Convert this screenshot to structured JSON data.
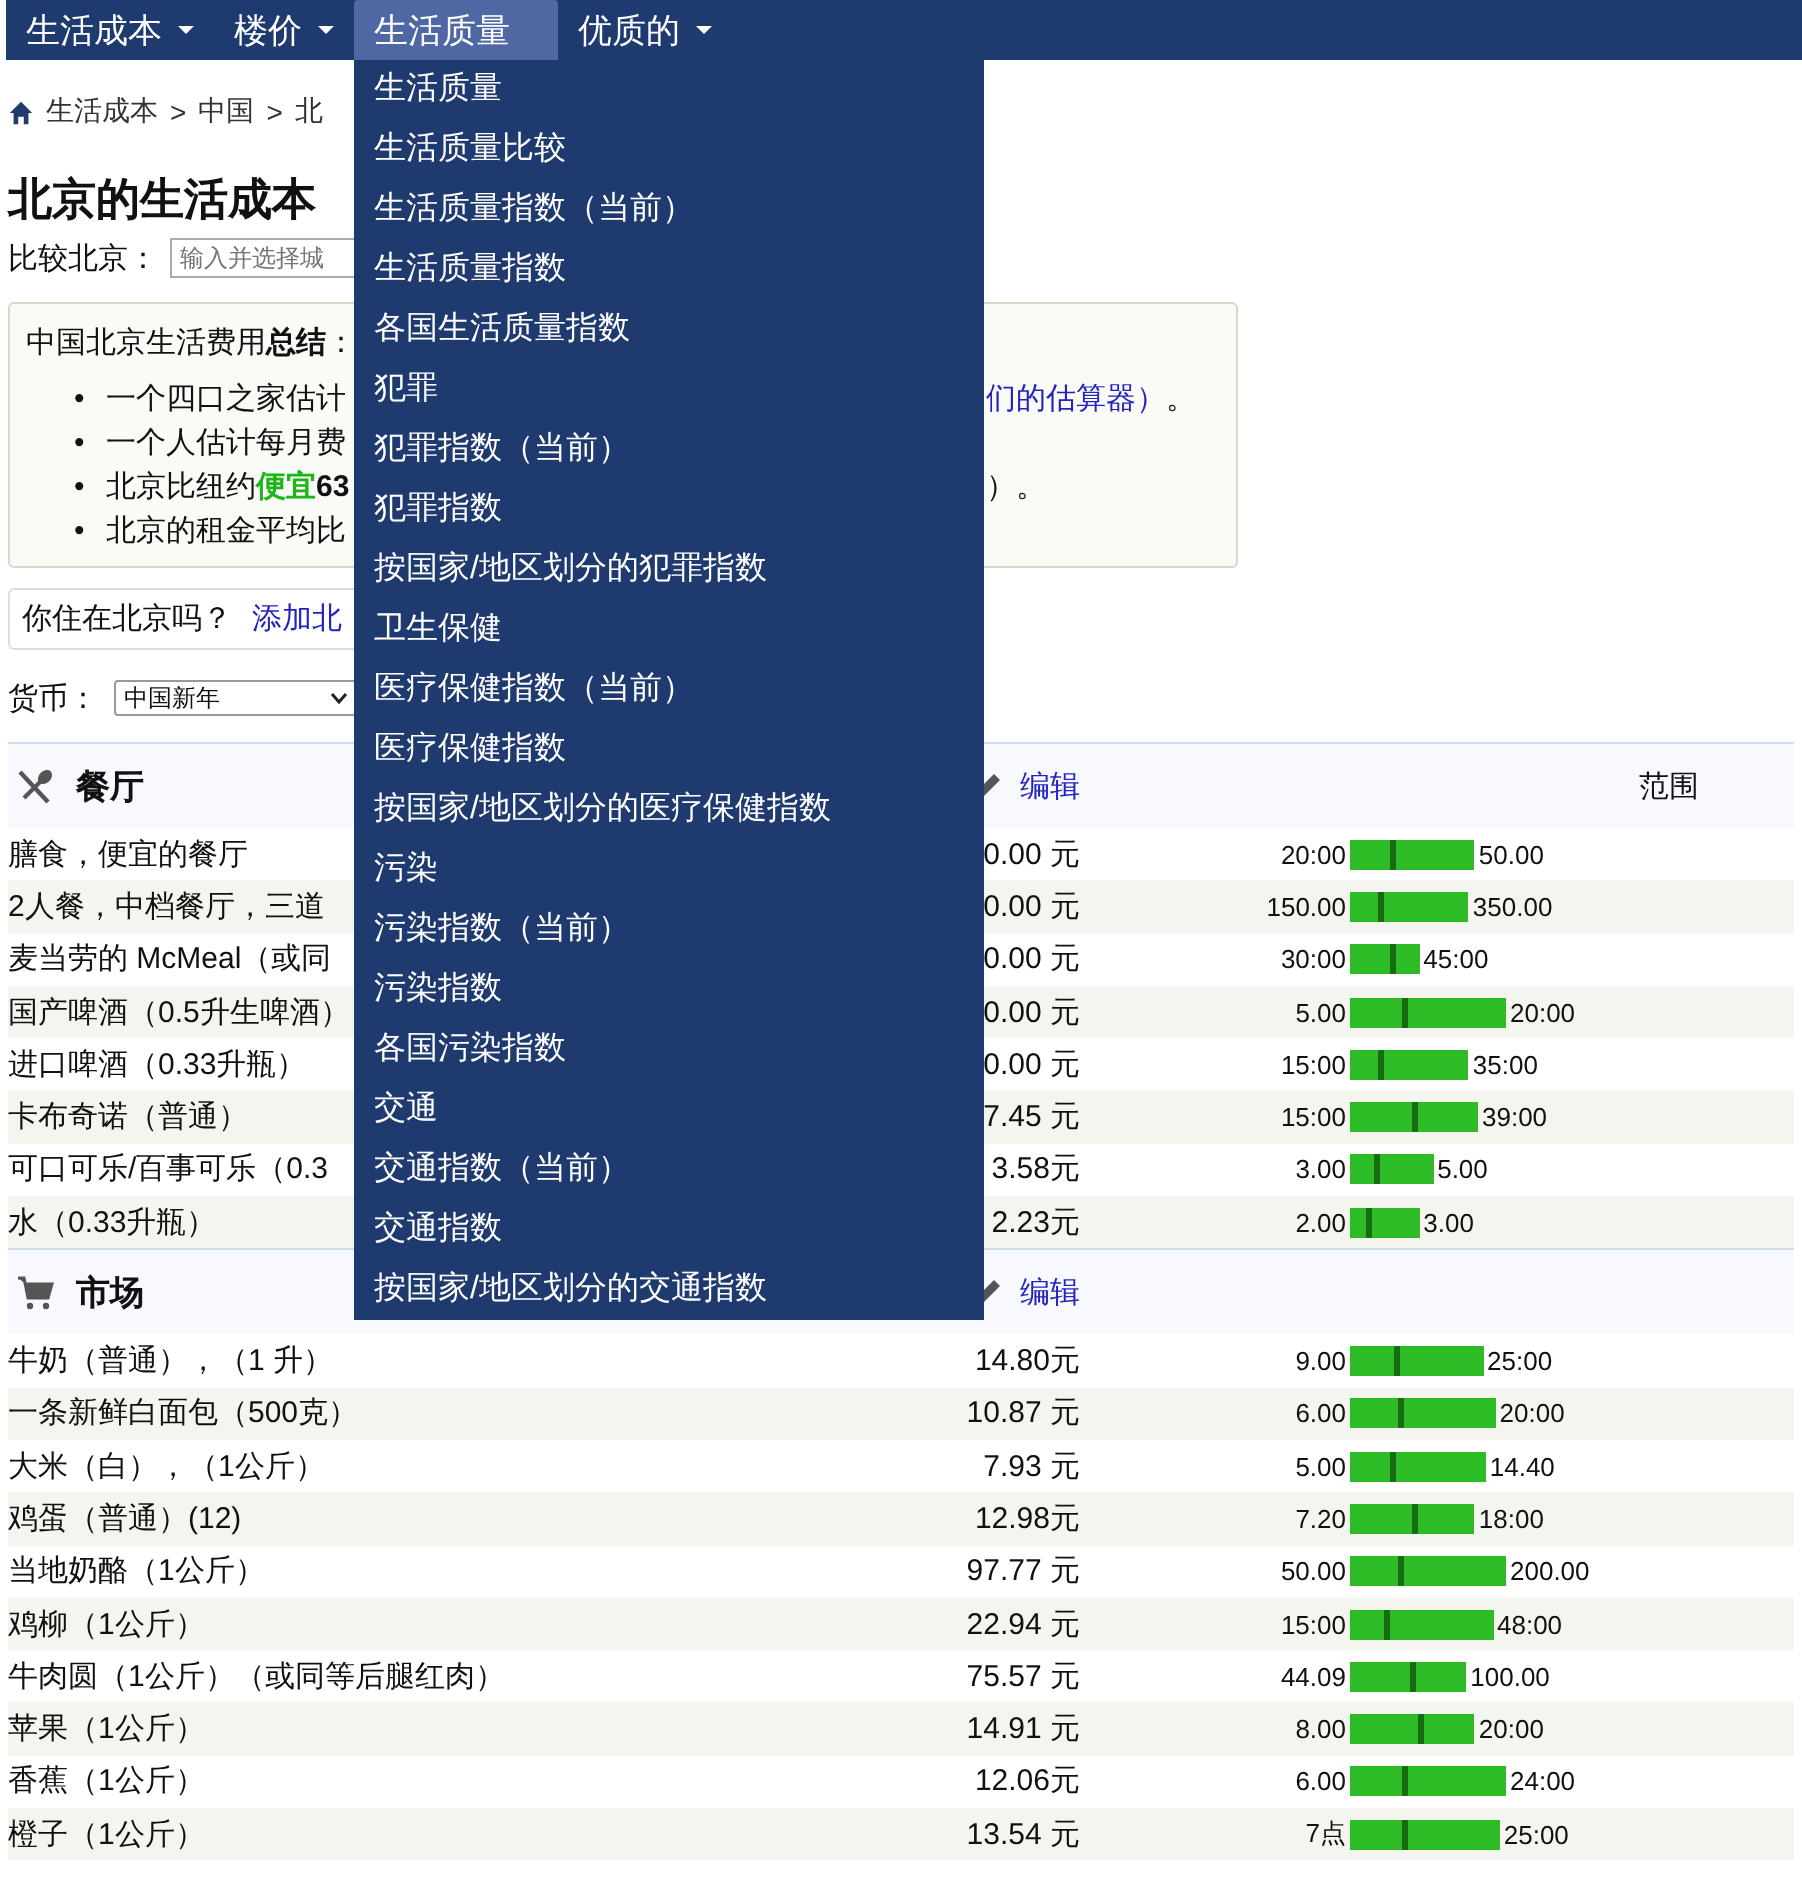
{
  "nav": {
    "items": [
      {
        "label": "生活成本",
        "selected": false,
        "caret": true
      },
      {
        "label": "楼价",
        "selected": false,
        "caret": true
      },
      {
        "label": "生活质量",
        "selected": true,
        "caret": false
      },
      {
        "label": "优质的",
        "selected": false,
        "caret": true
      }
    ]
  },
  "dropdown": {
    "items": [
      "生活质量",
      "生活质量比较",
      "生活质量指数（当前）",
      "生活质量指数",
      "各国生活质量指数",
      "犯罪",
      "犯罪指数（当前）",
      "犯罪指数",
      "按国家/地区划分的犯罪指数",
      "卫生保健",
      "医疗保健指数（当前）",
      "医疗保健指数",
      "按国家/地区划分的医疗保健指数",
      "污染",
      "污染指数（当前）",
      "污染指数",
      "各国污染指数",
      "交通",
      "交通指数（当前）",
      "交通指数",
      "按国家/地区划分的交通指数"
    ]
  },
  "breadcrumb": [
    "生活成本",
    ">",
    "中国",
    ">",
    "北"
  ],
  "title": "北京的生活成本",
  "compare": {
    "label": "比较北京：",
    "placeholder": "输入并选择城"
  },
  "summary": {
    "heading": "中国北京生活费用**总结**：",
    "bullets": [
      {
        "marker": "•",
        "parts": [
          {
            "kind": "plain",
            "text": "一个四口之家估计"
          }
        ],
        "link": "们的估算器）",
        "tail": "。"
      },
      {
        "marker": "•",
        "parts": [
          {
            "kind": "plain",
            "text": "一个人估计每月费"
          }
        ]
      },
      {
        "marker": "•",
        "parts": [
          {
            "kind": "plain",
            "text": "北京比纽约"
          },
          {
            "kind": "highlight",
            "text": "便宜"
          },
          {
            "kind": "bold",
            "text": "63"
          }
        ],
        "tail": "）。"
      },
      {
        "marker": "•",
        "parts": [
          {
            "kind": "plain",
            "text": "北京的租金平均比"
          }
        ]
      }
    ]
  },
  "live_here": {
    "question": "你住在北京吗？",
    "link": "添加北"
  },
  "currency": {
    "label": "货币：",
    "value": "中国新年"
  },
  "sections": [
    {
      "kind": "restaurant",
      "title": "餐厅",
      "edit": "编辑",
      "range_header": "范围",
      "rows": [
        {
          "name": "膳食，便宜的餐厅",
          "price": "0.00 元",
          "low": "20:00",
          "high": "50.00",
          "level": 0.34
        },
        {
          "name": "2人餐，中档餐厅，三道",
          "price": "0.00 元",
          "low": "150.00",
          "high": "350.00",
          "level": 0.26
        },
        {
          "name": "麦当劳的 McMeal（或同",
          "price": "0.00 元",
          "low": "30:00",
          "high": "45:00",
          "level": 0.6
        },
        {
          "name": "国产啤酒（0.5升生啤酒）",
          "price": "0.00 元",
          "low": "5.00",
          "high": "20:00",
          "level": 0.34
        },
        {
          "name": "进口啤酒（0.33升瓶）",
          "price": "0.00 元",
          "low": "15:00",
          "high": "35:00",
          "level": 0.26
        },
        {
          "name": "卡布奇诺（普通）",
          "price": "7.45 元",
          "low": "15:00",
          "high": "39:00",
          "level": 0.5
        },
        {
          "name": "可口可乐/百事可乐（0.3",
          "price": "3.58元",
          "low": "3.00",
          "high": "5.00",
          "level": 0.31
        },
        {
          "name": "水（0.33升瓶）",
          "price": "2.23元",
          "low": "2.00",
          "high": "3.00",
          "level": 0.26
        }
      ]
    },
    {
      "kind": "market",
      "title": "市场",
      "edit": "编辑",
      "rows": [
        {
          "name": "牛奶（普通），（1 升）",
          "price": "14.80元",
          "low": "9.00",
          "high": "25:00",
          "level": 0.35
        },
        {
          "name": "一条新鲜白面包（500克）",
          "price": "10.87 元",
          "low": "6.00",
          "high": "20:00",
          "level": 0.35
        },
        {
          "name": "大米（白），（1公斤）",
          "price": "7.93 元",
          "low": "5.00",
          "high": "14.40",
          "level": 0.31
        },
        {
          "name": "鸡蛋（普通）(12)",
          "price": "12.98元",
          "low": "7.20",
          "high": "18:00",
          "level": 0.52
        },
        {
          "name": "当地奶酪（1公斤）",
          "price": "97.77 元",
          "low": "50.00",
          "high": "200.00",
          "level": 0.32
        },
        {
          "name": "鸡柳（1公斤）",
          "price": "22.94 元",
          "low": "15:00",
          "high": "48:00",
          "level": 0.25
        },
        {
          "name": "牛肉圆（1公斤）（或同等后腿红肉）",
          "price": "75.57 元",
          "low": "44.09",
          "high": "100.00",
          "level": 0.54
        },
        {
          "name": "苹果（1公斤）",
          "price": "14.91 元",
          "low": "8.00",
          "high": "20:00",
          "level": 0.56
        },
        {
          "name": "香蕉（1公斤）",
          "price": "12.06元",
          "low": "6.00",
          "high": "24:00",
          "level": 0.34
        },
        {
          "name": "橙子（1公斤）",
          "price": "13.54 元",
          "low": "7点",
          "high": "25:00",
          "level": 0.36
        }
      ]
    }
  ]
}
